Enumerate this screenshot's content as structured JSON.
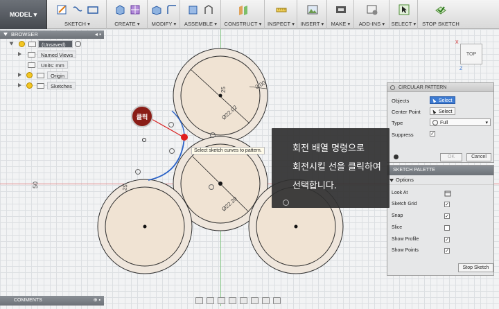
{
  "toolbar": {
    "model_label": "MODEL ▾",
    "groups": [
      {
        "label": "SKETCH ▾"
      },
      {
        "label": "CREATE ▾"
      },
      {
        "label": "MODIFY ▾"
      },
      {
        "label": "ASSEMBLE ▾"
      },
      {
        "label": "CONSTRUCT ▾"
      },
      {
        "label": "INSPECT ▾"
      },
      {
        "label": "INSERT ▾"
      },
      {
        "label": "MAKE ▾"
      },
      {
        "label": "ADD-INS ▾"
      },
      {
        "label": "SELECT ▾"
      },
      {
        "label": "STOP SKETCH"
      }
    ]
  },
  "browser": {
    "title": "BROWSER",
    "root": "(Unsaved)",
    "items": [
      "Named Views",
      "Units: mm",
      "Origin",
      "Sketches"
    ]
  },
  "viewcube": {
    "face": "TOP",
    "x": "X",
    "z": "Z"
  },
  "circular_pattern": {
    "title": "CIRCULAR PATTERN",
    "objects_label": "Objects",
    "objects_btn": "Select",
    "center_label": "Center Point",
    "center_btn": "Select",
    "type_label": "Type",
    "type_value": "Full",
    "suppress_label": "Suppress",
    "ok": "OK",
    "cancel": "Cancel"
  },
  "sketch_palette": {
    "title": "SKETCH PALETTE",
    "options_label": "Options",
    "rows": [
      {
        "label": "Look At"
      },
      {
        "label": "Sketch Grid",
        "checked": true
      },
      {
        "label": "Snap",
        "checked": true
      },
      {
        "label": "Slice",
        "checked": false
      },
      {
        "label": "Show Profile",
        "checked": true
      },
      {
        "label": "Show Points",
        "checked": true
      }
    ],
    "stop_sketch": "Stop Sketch"
  },
  "overlay": {
    "line1": "회전 배열 명령으로",
    "line2": "회전시킬 선을 클릭하여",
    "line3": "선택합니다."
  },
  "click_badge": "클릭",
  "sketch_tooltip": "Select sketch curves to pattern.",
  "dimensions": {
    "top_diam": "Ø22.02",
    "top_small": "25",
    "top_offset": "2.00",
    "center_diam": "Ø22.20",
    "left_small": "25",
    "side_50": "50"
  },
  "comments": {
    "label": "COMMENTS"
  },
  "colors": {
    "accent": "#3d7bd2",
    "badge": "#8a1d17",
    "circle_fill": "#efe6dc",
    "selected_curve": "#2a62c7",
    "point": "#e01e1e"
  }
}
